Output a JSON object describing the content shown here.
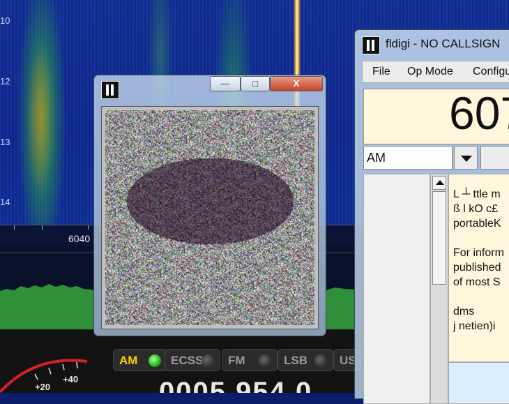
{
  "sdr": {
    "waterfall_ticks": [
      "10",
      "12",
      "13",
      "14"
    ],
    "frequency_scale_label": "6040",
    "smeter_labels": [
      "+20",
      "+40"
    ],
    "mode_buttons": [
      {
        "label": "AM",
        "active": true
      },
      {
        "label": "ECSS",
        "active": false
      },
      {
        "label": "FM",
        "active": false
      },
      {
        "label": "LSB",
        "active": false
      },
      {
        "label": "US",
        "active": false
      }
    ],
    "frequency_digits": "0005 954.0"
  },
  "image_window": {
    "buttons": {
      "minimize": "—",
      "maximize": "□",
      "close": "X"
    },
    "content": "received SSTV image (noisy)"
  },
  "fldigi": {
    "title": "fldigi - NO CALLSIGN",
    "menu": [
      "File",
      "Op Mode",
      "Configu"
    ],
    "frequency": "607",
    "mode": "AM",
    "rx_text": [
      "L ┴ ttle m",
      " ß l kO c£",
      "portableK",
      "",
      "For inform",
      "published",
      "of most S",
      "",
      "dms",
      "j netien)i"
    ]
  },
  "colors": {
    "waterfall_bg": "#10318f",
    "rx_bg": "#fff8dc",
    "freq_bg": "#fff8dd",
    "am_active": "#ffd000",
    "led_on": "#21c21f"
  }
}
